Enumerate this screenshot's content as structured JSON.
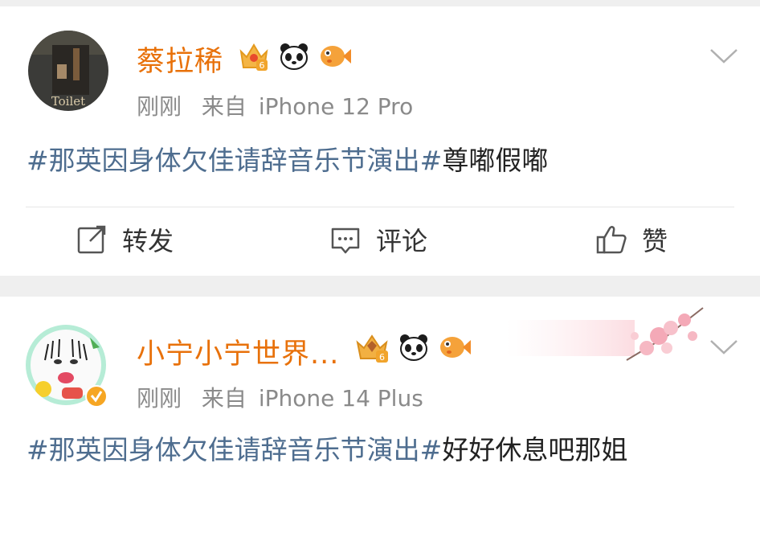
{
  "posts": [
    {
      "username": "蔡拉稀",
      "avatar_text": "Toilet",
      "badge_level": "6",
      "time": "刚刚",
      "source": "来自",
      "device": "iPhone 12 Pro",
      "hashtag": "#那英因身体欠佳请辞音乐节演出#",
      "text": "尊嘟假嘟",
      "actions": {
        "repost": "转发",
        "comment": "评论",
        "like": "赞"
      }
    },
    {
      "username": "小宁小宁世界...",
      "badge_level": "6",
      "time": "刚刚",
      "source": "来自",
      "device": "iPhone 14 Plus",
      "hashtag": "#那英因身体欠佳请辞音乐节演出#",
      "text": "好好休息吧那姐"
    }
  ],
  "colors": {
    "username": "#e8710a",
    "hashtag": "#4e6d8f",
    "meta": "#8a8a8a"
  },
  "icons": [
    "crown-badge-icon",
    "panda-icon",
    "fish-icon",
    "chevron-down-icon",
    "repost-icon",
    "comment-icon",
    "like-icon",
    "verified-icon"
  ]
}
